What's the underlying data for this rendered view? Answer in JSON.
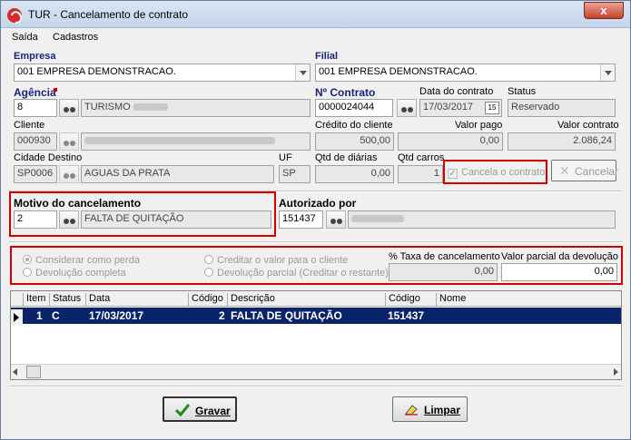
{
  "window": {
    "title": "TUR - Cancelamento de contrato",
    "close_label": "x"
  },
  "menu": {
    "items": [
      "Saída",
      "Cadastros"
    ]
  },
  "empresa": {
    "label": "Empresa",
    "value": "001 EMPRESA DEMONSTRACAO."
  },
  "filial": {
    "label": "Filial",
    "value": "001 EMPRESA DEMONSTRACAO."
  },
  "agencia": {
    "label": "Agência",
    "code": "8",
    "name": "TURISMO"
  },
  "contrato": {
    "label": "Nº Contrato",
    "value": "0000024044"
  },
  "data_contrato": {
    "label": "Data do contrato",
    "value": "17/03/2017",
    "cal_label": "15"
  },
  "status": {
    "label": "Status",
    "value": "Reservado"
  },
  "cliente": {
    "label": "Cliente",
    "code": "000930"
  },
  "credito": {
    "label": "Crédito do cliente",
    "value": "500,00"
  },
  "valor_pago": {
    "label": "Valor pago",
    "value": "0,00"
  },
  "valor_contrato": {
    "label": "Valor contrato",
    "value": "2.086,24"
  },
  "cidade": {
    "label": "Cidade Destino",
    "code": "SP0006",
    "name": "AGUAS DA PRATA"
  },
  "uf": {
    "label": "UF",
    "value": "SP"
  },
  "diarias": {
    "label": "Qtd de diárias",
    "value": "0,00"
  },
  "carros": {
    "label": "Qtd carros",
    "value": "1"
  },
  "cancela_check": {
    "label": "Cancela o contrato",
    "mark": "✓"
  },
  "cancelar_button": {
    "label": "Cancelar",
    "icon": "x-icon"
  },
  "motivo": {
    "label": "Motivo do cancelamento",
    "code": "2",
    "name": "FALTA DE QUITAÇÃO"
  },
  "autorizado": {
    "label": "Autorizado por",
    "code": "151437"
  },
  "options": {
    "perda": "Considerar como perda",
    "devolucao_completa": "Devolução completa",
    "creditar": "Creditar o valor para o cliente",
    "devolucao_parcial": "Devolução parcial (Creditar o restante)",
    "taxa_label": "% Taxa de cancelamento",
    "taxa_value": "0,00",
    "parcial_label": "Valor parcial da devolução",
    "parcial_value": "0,00"
  },
  "grid": {
    "columns": [
      "Item",
      "Status",
      "Data",
      "Código",
      "Descrição",
      "Código",
      "Nome"
    ],
    "rows": [
      {
        "item": "1",
        "status": "C",
        "data": "17/03/2017",
        "codigo": "2",
        "descricao": "FALTA DE QUITAÇÃO",
        "codigo2": "151437"
      }
    ]
  },
  "buttons": {
    "gravar": "Gravar",
    "limpar": "Limpar"
  },
  "colors": {
    "accent": "#0a246a",
    "highlight_border": "#d40000",
    "label_blue": "#1a237e"
  }
}
